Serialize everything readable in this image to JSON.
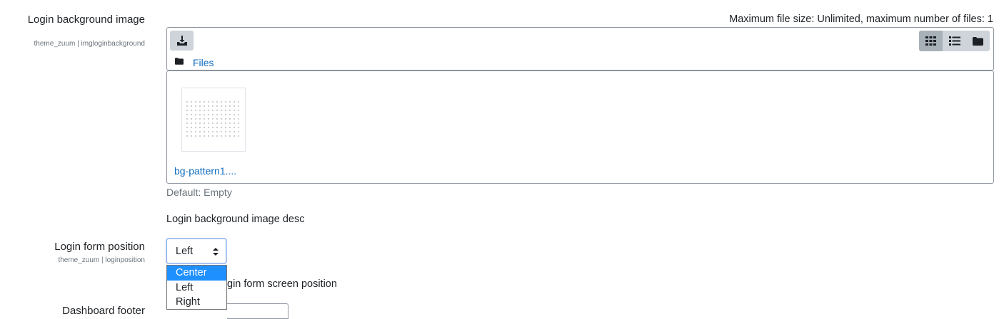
{
  "login_bg": {
    "label": "Login background image",
    "setting_id": "theme_zuum | imgloginbackground",
    "limits": "Maximum file size: Unlimited, maximum number of files: 1",
    "breadcrumb": "Files",
    "file_name": "bg-pattern1....",
    "default_text": "Default: Empty",
    "description": "Login background image desc"
  },
  "login_form": {
    "label": "Login form position",
    "setting_id": "theme_zuum | loginposition",
    "selected_value": "Left",
    "options": [
      "Center",
      "Left",
      "Right"
    ],
    "highlighted_option": "Center",
    "description_partial": "gin form screen position"
  },
  "dashboard_footer": {
    "label": "Dashboard footer"
  },
  "icons": {
    "add_file": "download-icon",
    "view_icons": "grid-icon",
    "view_list": "list-icon",
    "view_tree": "folder-icon",
    "breadcrumb_folder": "folder-icon"
  },
  "colors": {
    "link": "#0f6cbf",
    "option_highlight": "#1e90ff"
  }
}
